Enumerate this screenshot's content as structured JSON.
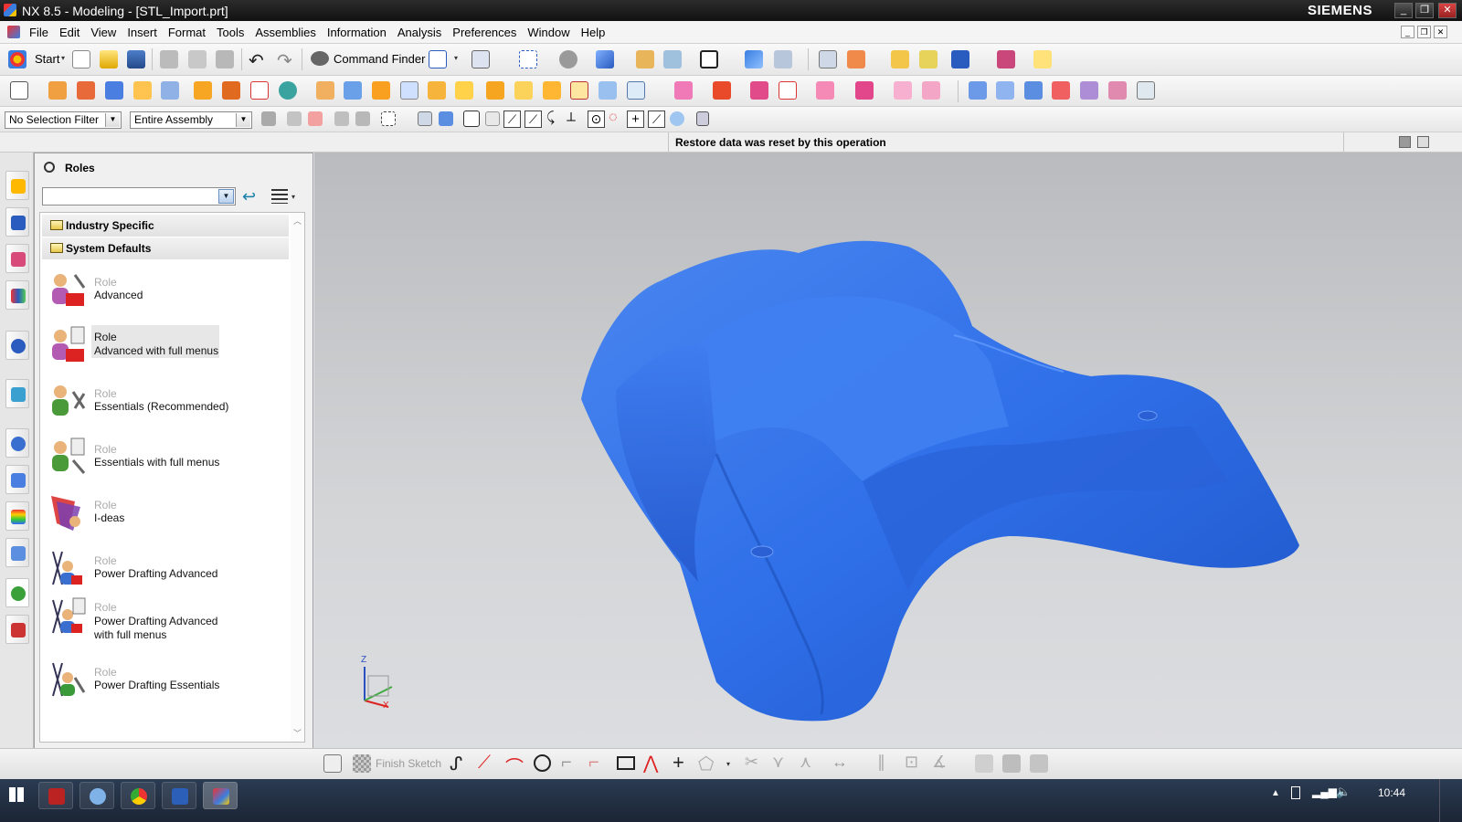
{
  "window": {
    "title": "NX 8.5 - Modeling - [STL_Import.prt]",
    "brand": "SIEMENS",
    "controls": [
      "_",
      "❐",
      "✕"
    ]
  },
  "menu": {
    "items": [
      "File",
      "Edit",
      "View",
      "Insert",
      "Format",
      "Tools",
      "Assemblies",
      "Information",
      "Analysis",
      "Preferences",
      "Window",
      "Help"
    ]
  },
  "toolbar": {
    "start_label": "Start",
    "command_finder_label": "Command Finder"
  },
  "selection": {
    "filter": "No Selection Filter",
    "scope": "Entire Assembly"
  },
  "status": {
    "message": "Restore data was reset by this operation"
  },
  "panel": {
    "title": "Roles",
    "combo_value": "",
    "groups": [
      {
        "label": "Industry Specific"
      },
      {
        "label": "System Defaults"
      }
    ],
    "roles": [
      {
        "label": "Role",
        "name": "Advanced",
        "selected": false
      },
      {
        "label": "Role",
        "name": "Advanced with full menus",
        "selected": true
      },
      {
        "label": "Role",
        "name": "Essentials (Recommended)",
        "selected": false
      },
      {
        "label": "Role",
        "name": "Essentials with full menus",
        "selected": false
      },
      {
        "label": "Role",
        "name": "I-deas",
        "selected": false
      },
      {
        "label": "Role",
        "name": "Power Drafting Advanced",
        "selected": false
      },
      {
        "label": "Role",
        "name": "Power Drafting Advanced",
        "name2": "with full menus",
        "selected": false
      },
      {
        "label": "Role",
        "name": "Power Drafting Essentials",
        "selected": false
      }
    ]
  },
  "triad": {
    "z": "Z",
    "x": "X"
  },
  "sketch": {
    "finish_label": "Finish Sketch"
  },
  "clock": {
    "time": "10:44"
  },
  "colors": {
    "model": "#2f6fe8",
    "title_bar": "#1a1a1a",
    "viewport_top": "#b9bbbe"
  }
}
